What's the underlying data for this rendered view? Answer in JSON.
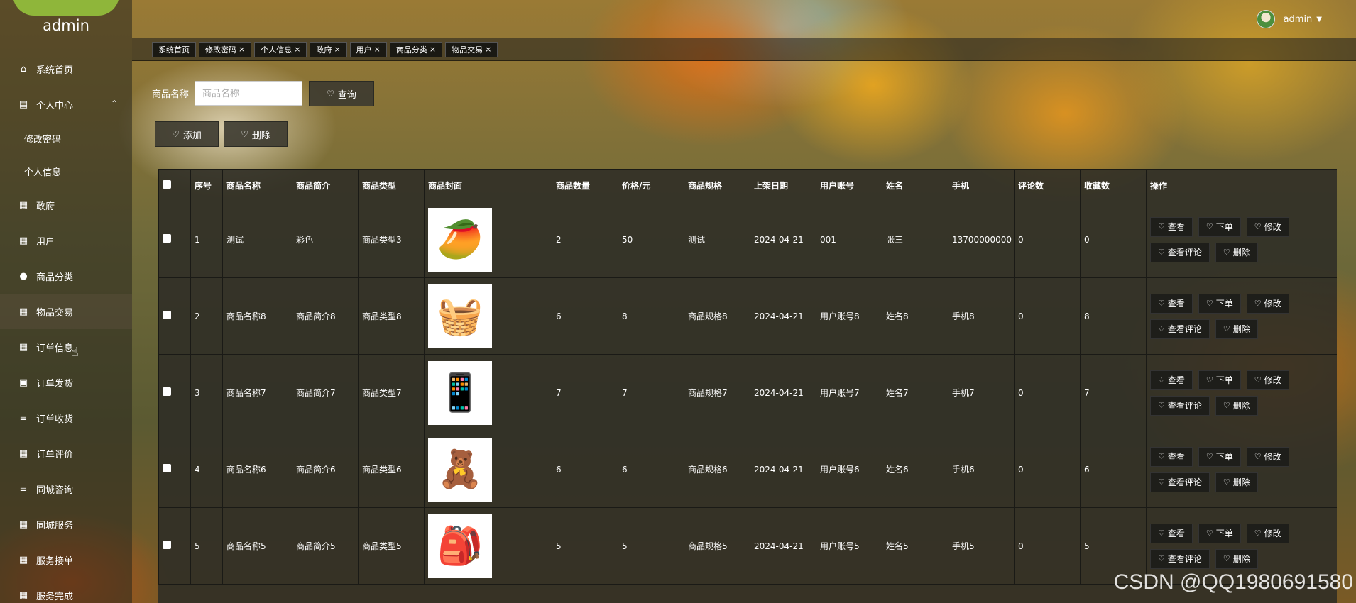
{
  "app": {
    "user_name": "admin"
  },
  "sidebar": {
    "items": [
      {
        "label": "系统首页",
        "icon": "home-icon"
      },
      {
        "label": "个人中心",
        "icon": "user-card-icon"
      },
      {
        "label": "修改密码"
      },
      {
        "label": "个人信息"
      },
      {
        "label": "政府",
        "icon": "book-icon"
      },
      {
        "label": "用户",
        "icon": "grid-icon"
      },
      {
        "label": "商品分类",
        "icon": "pin-icon"
      },
      {
        "label": "物品交易",
        "icon": "grid-icon"
      },
      {
        "label": "订单信息",
        "icon": "grid-icon"
      },
      {
        "label": "订单发货",
        "icon": "clipboard-icon"
      },
      {
        "label": "订单收货",
        "icon": "list-icon"
      },
      {
        "label": "订单评价",
        "icon": "grid-icon"
      },
      {
        "label": "同城咨询",
        "icon": "list-icon"
      },
      {
        "label": "同城服务",
        "icon": "grid-icon"
      },
      {
        "label": "服务接单",
        "icon": "grid-icon"
      },
      {
        "label": "服务完成",
        "icon": "grid-icon"
      }
    ]
  },
  "tags": [
    "系统首页",
    "修改密码",
    "个人信息",
    "政府",
    "用户",
    "商品分类",
    "物品交易"
  ],
  "search": {
    "label": "商品名称",
    "placeholder": "商品名称",
    "button": "查询"
  },
  "actions": {
    "add": "添加",
    "delete": "删除"
  },
  "table": {
    "headers": [
      "序号",
      "商品名称",
      "商品简介",
      "商品类型",
      "商品封面",
      "商品数量",
      "价格/元",
      "商品规格",
      "上架日期",
      "用户账号",
      "姓名",
      "手机",
      "评论数",
      "收藏数",
      "操作"
    ],
    "rows": [
      {
        "no": "1",
        "name": "测试",
        "intro": "彩色",
        "type": "商品类型3",
        "qty": "2",
        "price": "50",
        "spec": "测试",
        "date": "2024-04-21",
        "account": "001",
        "person": "张三",
        "phone": "13700000000",
        "comments": "0",
        "favs": "0",
        "img_color": "#e8a020",
        "img_icon": "🥭"
      },
      {
        "no": "2",
        "name": "商品名称8",
        "intro": "商品简介8",
        "type": "商品类型8",
        "qty": "6",
        "price": "8",
        "spec": "商品规格8",
        "date": "2024-04-21",
        "account": "用户账号8",
        "person": "姓名8",
        "phone": "手机8",
        "comments": "0",
        "favs": "8",
        "img_color": "#c49a50",
        "img_icon": "🧺"
      },
      {
        "no": "3",
        "name": "商品名称7",
        "intro": "商品简介7",
        "type": "商品类型7",
        "qty": "7",
        "price": "7",
        "spec": "商品规格7",
        "date": "2024-04-21",
        "account": "用户账号7",
        "person": "姓名7",
        "phone": "手机7",
        "comments": "0",
        "favs": "7",
        "img_color": "#222222",
        "img_icon": "📱"
      },
      {
        "no": "4",
        "name": "商品名称6",
        "intro": "商品简介6",
        "type": "商品类型6",
        "qty": "6",
        "price": "6",
        "spec": "商品规格6",
        "date": "2024-04-21",
        "account": "用户账号6",
        "person": "姓名6",
        "phone": "手机6",
        "comments": "0",
        "favs": "6",
        "img_color": "#d07030",
        "img_icon": "🧸"
      },
      {
        "no": "5",
        "name": "商品名称5",
        "intro": "商品简介5",
        "type": "商品类型5",
        "qty": "5",
        "price": "5",
        "spec": "商品规格5",
        "date": "2024-04-21",
        "account": "用户账号5",
        "person": "姓名5",
        "phone": "手机5",
        "comments": "0",
        "favs": "5",
        "img_color": "#283a60",
        "img_icon": "🎒"
      }
    ],
    "row_actions": [
      "查看",
      "下单",
      "修改",
      "查看评论",
      "删除"
    ]
  },
  "watermark": "CSDN @QQ1980691580",
  "colors": {
    "accent_logo": "#8fb63a"
  }
}
